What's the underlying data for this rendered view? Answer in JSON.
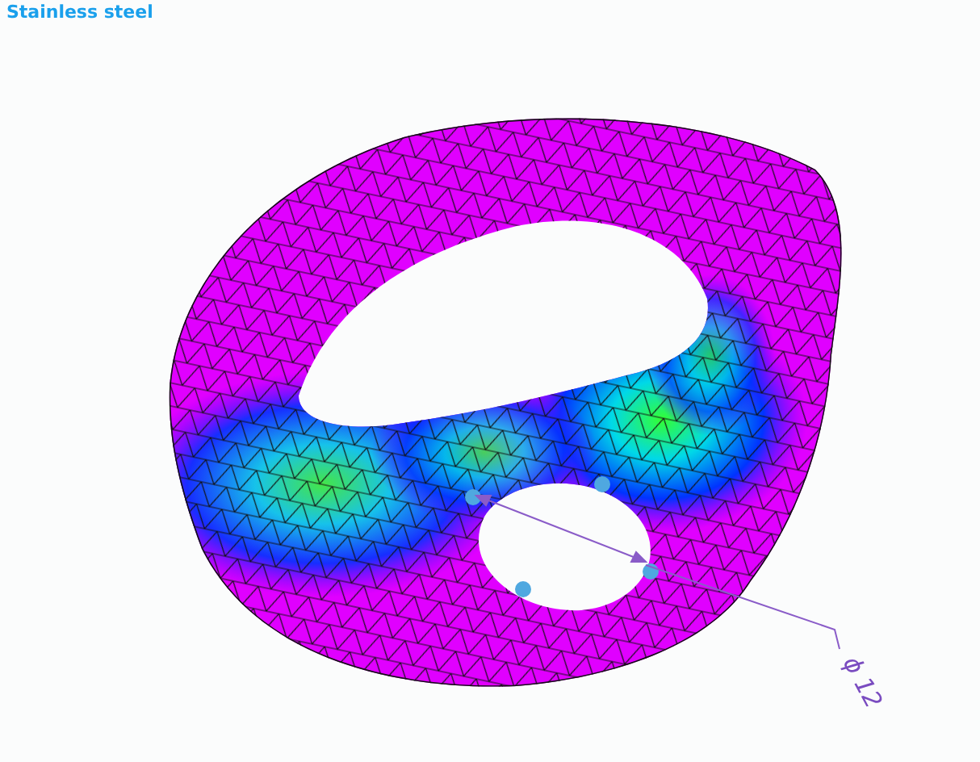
{
  "title": "Stainless steel",
  "dimension": {
    "label": "ϕ 12"
  }
}
